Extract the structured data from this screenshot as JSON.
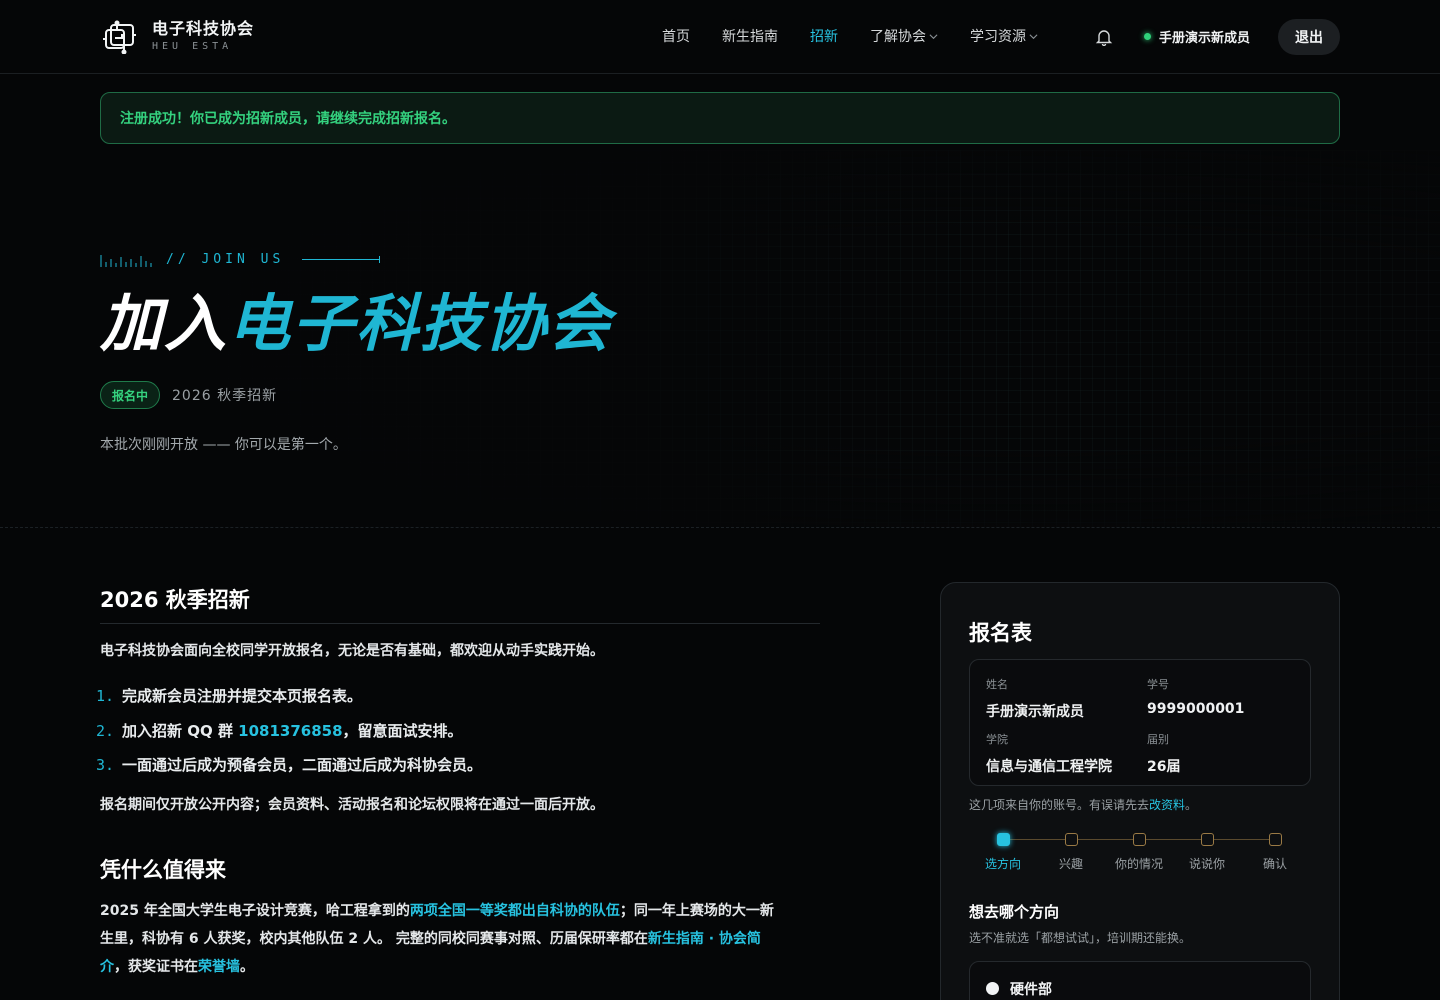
{
  "header": {
    "logo_cn": "电子科技协会",
    "logo_en": "HEU ESTA",
    "nav": [
      {
        "label": "首页",
        "active": false,
        "dropdown": false
      },
      {
        "label": "新生指南",
        "active": false,
        "dropdown": false
      },
      {
        "label": "招新",
        "active": true,
        "dropdown": false
      },
      {
        "label": "了解协会",
        "active": false,
        "dropdown": true
      },
      {
        "label": "学习资源",
        "active": false,
        "dropdown": true
      }
    ],
    "user_name": "手册演示新成员",
    "logout_label": "退出"
  },
  "alert": {
    "text": "注册成功！你已成为招新成员，请继续完成招新报名。"
  },
  "hero": {
    "eyebrow": "// JOIN US",
    "title_prefix": "加入",
    "title_accent": "电子科技协会",
    "badge": "报名中",
    "season": "2026 秋季招新",
    "subtitle": "本批次刚刚开放 —— 你可以是第一个。"
  },
  "section1": {
    "heading": "2026 秋季招新",
    "intro": "电子科技协会面向全校同学开放报名，无论是否有基础，都欢迎从动手实践开始。",
    "steps": [
      {
        "num": "1.",
        "text": "完成新会员注册并提交本页报名表。"
      },
      {
        "num": "2.",
        "pre": "加入招新 QQ 群 ",
        "highlight": "1081376858",
        "post": "，留意面试安排。"
      },
      {
        "num": "3.",
        "text": "一面通过后成为预备会员，二面通过后成为科协会员。"
      }
    ],
    "note": "报名期间仅开放公开内容；会员资料、活动报名和论坛权限将在通过一面后开放。"
  },
  "section2": {
    "heading": "凭什么值得来",
    "line1_pre": "2025 年全国大学生电子设计竞赛，哈工程拿到的",
    "line1_link": "两项全国一等奖都出自科协的队伍",
    "line1_post": "；同一年上赛场的大一新",
    "line2_pre": "生里，科协有 6 人获奖，校内其他队伍 2 人。 完整的同校同赛事对照、历届保研率都在",
    "line2_link": "新生指南 · 协会简",
    "line3_link": "介",
    "line3_mid": "，获奖证书在",
    "line3_link2": "荣誉墙",
    "line3_post": "。"
  },
  "form": {
    "title": "报名表",
    "fields": [
      {
        "label": "姓名",
        "value": "手册演示新成员"
      },
      {
        "label": "学号",
        "value": "9999000001"
      },
      {
        "label": "学院",
        "value": "信息与通信工程学院"
      },
      {
        "label": "届别",
        "value": "26届"
      }
    ],
    "note_pre": "这几项来自你的账号。有误请先去",
    "note_link": "改资料",
    "note_post": "。",
    "steps": [
      {
        "label": "选方向",
        "active": true
      },
      {
        "label": "兴趣",
        "active": false
      },
      {
        "label": "你的情况",
        "active": false
      },
      {
        "label": "说说你",
        "active": false
      },
      {
        "label": "确认",
        "active": false
      }
    ],
    "question_title": "想去哪个方向",
    "question_sub": "选不准就选「都想试试」，培训期还能换。",
    "option_label": "硬件部",
    "accent_color": "#27c2e0",
    "success_color": "#34d27f"
  }
}
